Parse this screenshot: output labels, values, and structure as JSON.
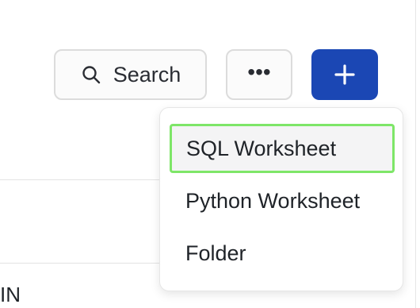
{
  "toolbar": {
    "search_label": "Search",
    "more_label": "•••",
    "search_icon": "search-icon",
    "more_icon": "more-horizontal-icon",
    "add_icon": "plus-icon",
    "add_color": "#1b47b4"
  },
  "create_menu": {
    "items": [
      {
        "label": "SQL Worksheet"
      },
      {
        "label": "Python Worksheet"
      },
      {
        "label": "Folder"
      }
    ],
    "highlight_color": "#7ee668"
  },
  "background": {
    "partial_row_text": "IN"
  }
}
